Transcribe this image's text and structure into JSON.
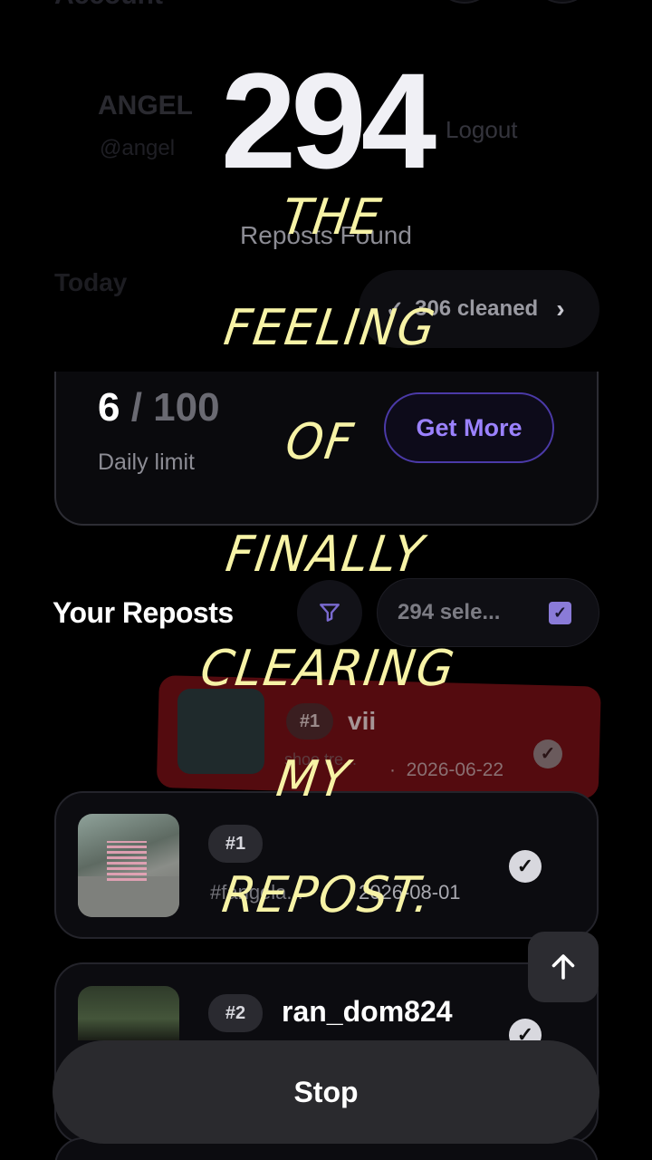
{
  "header": {
    "title": "Account"
  },
  "account": {
    "name": "ANGEL",
    "handle": "@angel",
    "logout_label": "Logout"
  },
  "today_label": "Today",
  "stats": {
    "reposts_found_count": "294",
    "reposts_found_label": "Reposts Found",
    "cleaned_label": "306 cleaned"
  },
  "limit": {
    "used": "6",
    "total": "100",
    "label": "Daily limit",
    "get_more_label": "Get More"
  },
  "reposts": {
    "title": "Your Reposts",
    "selection_label": "294 sele...",
    "items": [
      {
        "rank": "#1",
        "name": "vii",
        "caption": "shoe tre...",
        "date": "2026-06-22",
        "state": "swiping-delete"
      },
      {
        "rank": "#1",
        "name": "",
        "caption": "#fangela...",
        "date": "2026-08-01"
      },
      {
        "rank": "#2",
        "name": "ran_dom824",
        "caption": "",
        "date": ""
      }
    ]
  },
  "actions": {
    "stop_label": "Stop"
  },
  "overlay_caption": [
    "THE",
    "FEELING",
    "OF",
    "FINALLY",
    "CLEARING",
    "MY",
    "REPOST."
  ],
  "colors": {
    "accent": "#9b82ff",
    "caption": "#f7f3a6",
    "delete_swipe": "#540b0f"
  }
}
